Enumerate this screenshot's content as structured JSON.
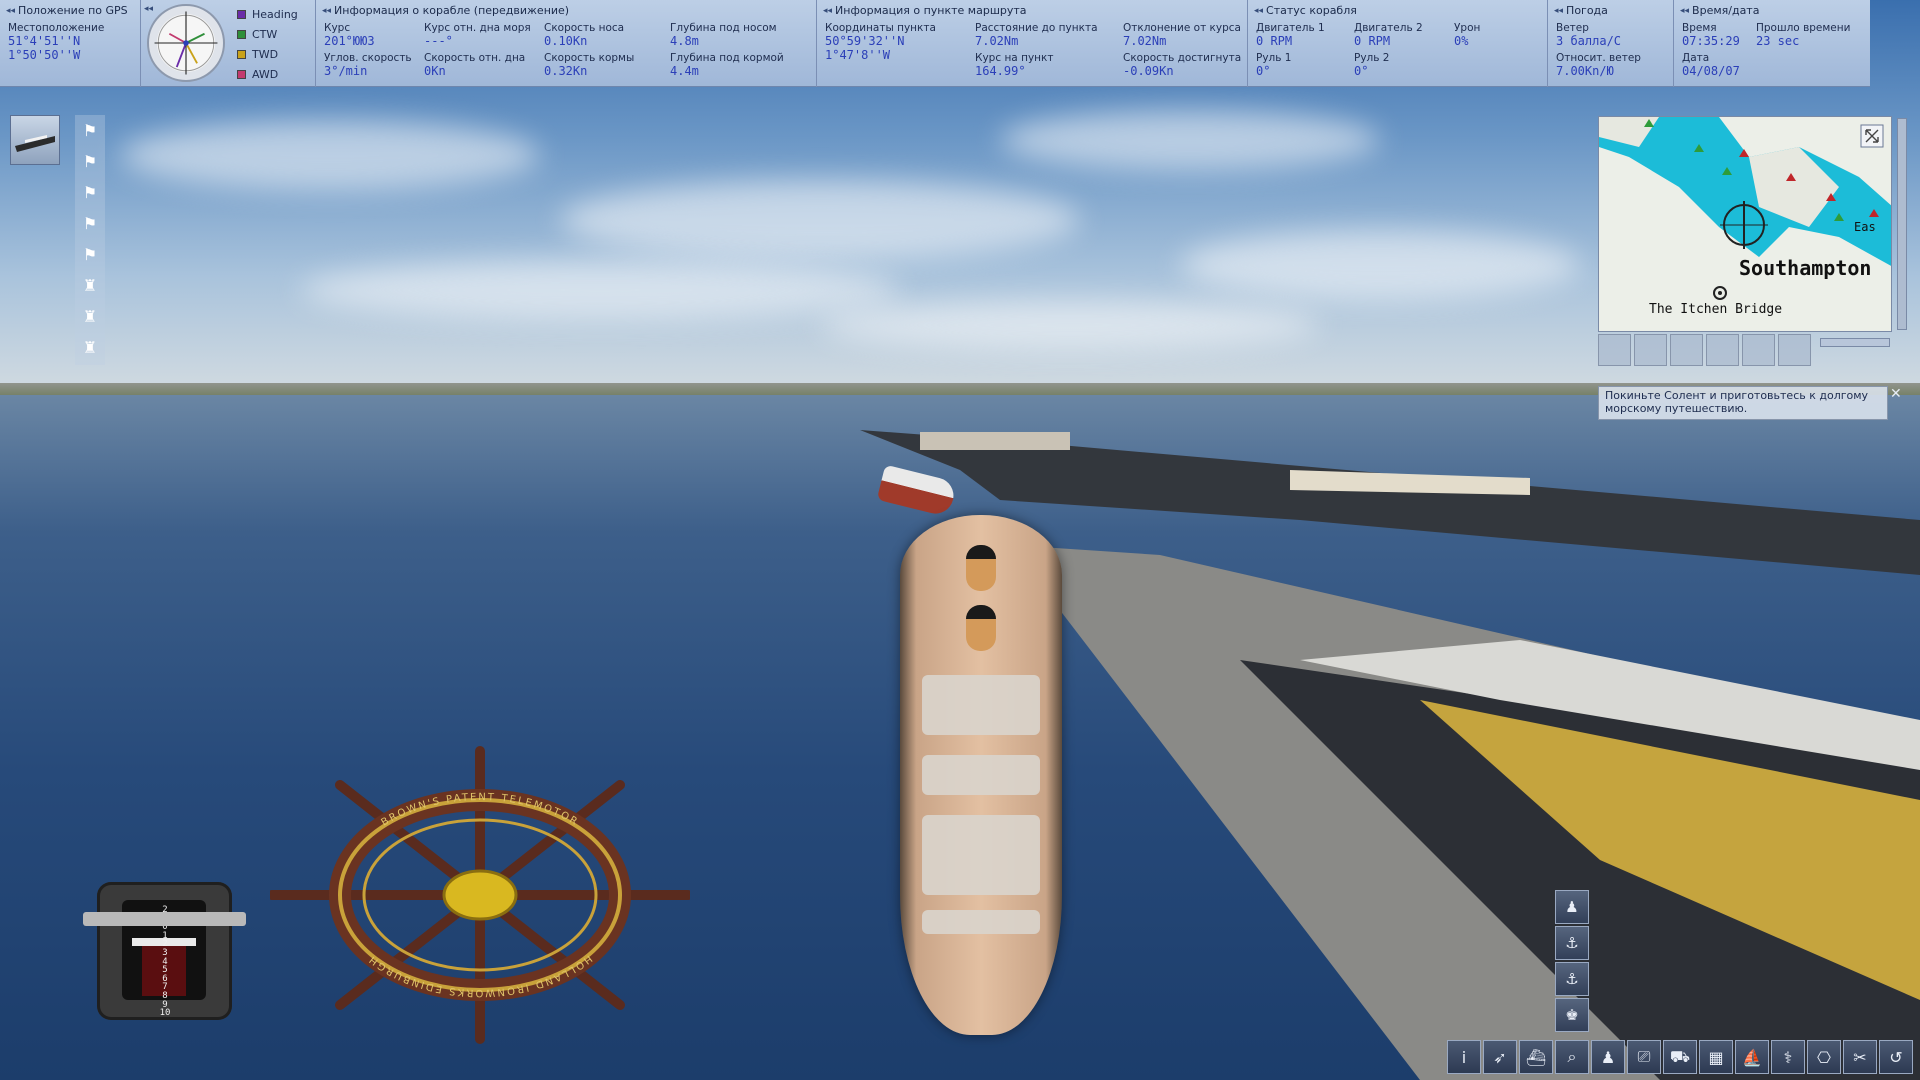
{
  "gps": {
    "title": "Положение по GPS",
    "location_label": "Местоположение",
    "lat": "51°4'51''N",
    "lon": "1°50'50''W"
  },
  "compass": {
    "legend": [
      {
        "name": "Heading",
        "color": "#6a2ca8"
      },
      {
        "name": "CTW",
        "color": "#2f8f3a"
      },
      {
        "name": "TWD",
        "color": "#c9a21a"
      },
      {
        "name": "AWD",
        "color": "#c23a6e"
      }
    ]
  },
  "ship_info": {
    "title": "Информация о корабле (передвижение)",
    "course_label": "Курс",
    "course": "201°ЮЮЗ",
    "course_ground_label": "Курс отн. дна моря",
    "course_ground": "---°",
    "bow_speed_label": "Скорость носа",
    "bow_speed": "0.10Kn",
    "depth_bow_label": "Глубина под носом",
    "depth_bow": "4.8m",
    "rot_label": "Углов. скорость",
    "rot": "3°/min",
    "speed_ground_label": "Скорость отн. дна",
    "speed_ground": "0Kn",
    "stern_speed_label": "Скорость кормы",
    "stern_speed": "0.32Kn",
    "depth_stern_label": "Глубина под кормой",
    "depth_stern": "4.4m"
  },
  "waypoint": {
    "title": "Информация о пункте маршрута",
    "coords_label": "Координаты пункта",
    "lat": "50°59'32''N",
    "lon": "1°47'8''W",
    "distance_label": "Расстояние до пункта",
    "distance": "7.02Nm",
    "bearing_label": "Курс на пункт",
    "bearing": "164.99°",
    "offset_label": "Отклонение от курса",
    "offset": "7.02Nm",
    "speed_reached_label": "Скорость достигнута",
    "speed_reached": "-0.09Kn"
  },
  "ship_status": {
    "title": "Статус корабля",
    "engine1_label": "Двигатель 1",
    "engine1": "0 RPM",
    "engine2_label": "Двигатель 2",
    "engine2": "0 RPM",
    "damage_label": "Урон",
    "damage": "0%",
    "rudder1_label": "Руль 1",
    "rudder1": "0°",
    "rudder2_label": "Руль 2",
    "rudder2": "0°"
  },
  "weather": {
    "title": "Погода",
    "wind_label": "Ветер",
    "wind": "3 балла/С",
    "rel_wind_label": "Относит. ветер",
    "rel_wind": "7.00Kn/Ю"
  },
  "datetime": {
    "title": "Время/дата",
    "time_label": "Время",
    "time": "07:35:29",
    "elapsed_label": "Прошло времени",
    "elapsed": "23 sec",
    "date_label": "Дата",
    "date": "04/08/07"
  },
  "minimap": {
    "city": "Southampton",
    "bridge": "The Itchen Bridge",
    "side_label": "Eas"
  },
  "message": {
    "text": "Покиньте Солент и приготовьтесь к долгому морскому путешествию."
  },
  "wheel": {
    "inscription_top": "BROWN'S PATENT TELEMOTOR",
    "inscription_bottom": "HOLLAND IRONWORKS EDINBURGH"
  },
  "telegraph": {
    "scale": [
      "2",
      "1",
      "0",
      "1",
      "2",
      "3",
      "4",
      "5",
      "6",
      "7",
      "8",
      "9",
      "10"
    ]
  }
}
